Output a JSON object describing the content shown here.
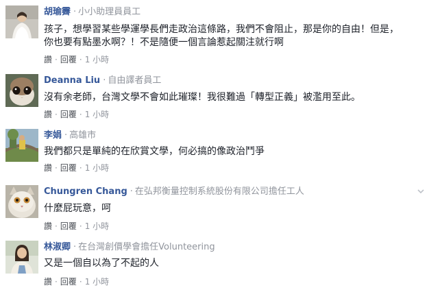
{
  "comments": [
    {
      "author": "胡瑜霽",
      "separator": "·",
      "job": "小小助理員員工",
      "lines": [
        "孩子，想學習某些學運學長們走政治這條路，我們不會阻止，那是你的自由！但是，",
        "你也要有點墨水啊？！不是隨便一個言論惹起關注就行啊"
      ],
      "reply_actions": {
        "like": "讚",
        "reply": "回覆",
        "time": "1 小時"
      }
    },
    {
      "author": "Deanna Liu",
      "separator": "·",
      "job": "自由譯者員工",
      "lines": [
        "沒有余老師，台灣文學不會如此璀璨！我很難過「轉型正義」被濫用至此。"
      ],
      "reply_actions": {
        "like": "讚",
        "reply": "回覆",
        "time": "1 小時"
      }
    },
    {
      "author": "李娟",
      "separator": "·",
      "job": "高雄市",
      "lines": [
        "我們都只是單純的在欣賞文學，何必搞的像政治鬥爭"
      ],
      "reply_actions": {
        "like": "讚",
        "reply": "回覆",
        "time": "1 小時"
      }
    },
    {
      "author": "Chungren Chang",
      "separator": "·",
      "job": "在弘邦衡量控制系統股份有限公司擔任工人",
      "lines": [
        "什麼屁玩意，呵"
      ],
      "reply_actions": {
        "like": "讚",
        "reply": "回覆",
        "time": "1 小時"
      }
    },
    {
      "author": "林淑卿",
      "separator": "·",
      "job": "在台灣創價學會擔任Volunteering",
      "lines": [
        "又是一個自以為了不起的人"
      ],
      "reply_actions": {
        "like": "讚",
        "reply": "回覆",
        "time": "1 小時"
      }
    }
  ],
  "icons": {
    "menu_chevron": "chevron-down-icon"
  },
  "colors": {
    "author": "#365899",
    "meta": "#90949c",
    "text": "#1d2129",
    "link": "#4b4f56"
  }
}
